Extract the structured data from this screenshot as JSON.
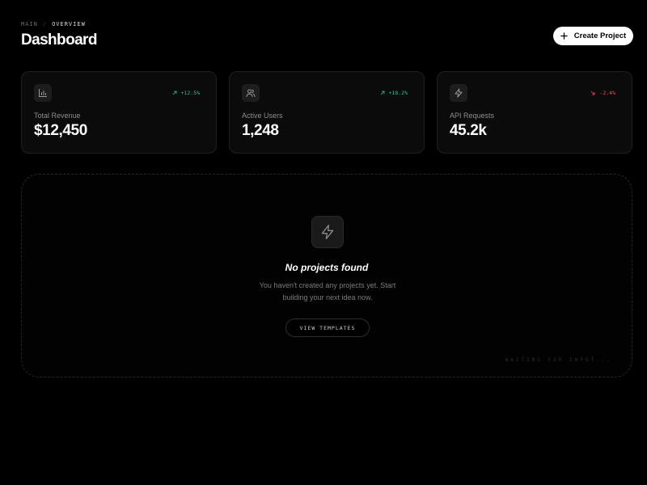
{
  "breadcrumb": {
    "root": "MAIN",
    "current": "OVERVIEW"
  },
  "header": {
    "title": "Dashboard",
    "create_label": "Create Project"
  },
  "stats": [
    {
      "label": "Total Revenue",
      "value": "$12,450",
      "trend": "+12.5%",
      "direction": "up",
      "icon": "bar-chart-icon"
    },
    {
      "label": "Active Users",
      "value": "1,248",
      "trend": "+18.2%",
      "direction": "up",
      "icon": "users-icon"
    },
    {
      "label": "API Requests",
      "value": "45.2k",
      "trend": "-2.4%",
      "direction": "down",
      "icon": "lightning-icon"
    }
  ],
  "empty_state": {
    "title": "No projects found",
    "description": "You haven't created any projects yet. Start building your next idea now.",
    "button_label": "VIEW TEMPLATES",
    "status": "WAITING FOR INPUT..."
  },
  "colors": {
    "positive": "#2bc48a",
    "negative": "#ff4a5e",
    "background": "#000000",
    "accent": "#ffffff"
  }
}
